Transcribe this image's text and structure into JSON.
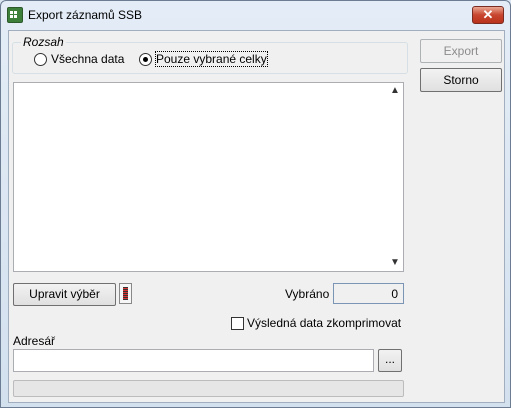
{
  "window": {
    "title": "Export záznamů SSB",
    "close_label": "✕"
  },
  "range_group": {
    "label": "Rozsah",
    "options": [
      {
        "label": "Všechna data",
        "selected": false
      },
      {
        "label": "Pouze vybrané celky",
        "selected": true
      }
    ]
  },
  "list": {
    "items": [],
    "scroll_up_icon": "chevron-up-icon",
    "scroll_down_icon": "chevron-down-icon"
  },
  "buttons": {
    "export_label": "Export",
    "export_enabled": false,
    "cancel_label": "Storno",
    "edit_selection_label": "Upravit výběr",
    "browse_label": "..."
  },
  "selection": {
    "count_label": "Vybráno",
    "count_value": "0"
  },
  "compress": {
    "label": "Výsledná data zkomprimovat",
    "checked": false
  },
  "directory": {
    "label": "Adresář",
    "value": ""
  },
  "progress": {
    "value": 0
  },
  "colors": {
    "close_button": "#c8452f",
    "client_bg": "#f0f0f0",
    "progress_fill": "#06b025"
  }
}
